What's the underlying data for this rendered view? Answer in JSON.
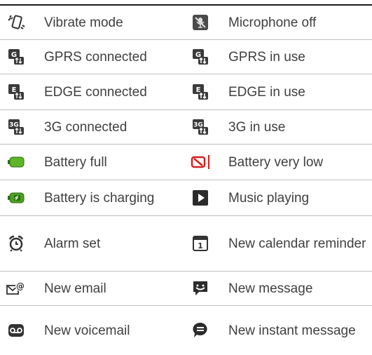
{
  "rows": [
    {
      "left": {
        "icon": "vibrate-icon",
        "label": "Vibrate mode"
      },
      "right": {
        "icon": "microphone-off-icon",
        "label": "Microphone off"
      }
    },
    {
      "left": {
        "icon": "gprs-connected-icon",
        "label": "GPRS connected"
      },
      "right": {
        "icon": "gprs-in-use-icon",
        "label": "GPRS in use"
      }
    },
    {
      "left": {
        "icon": "edge-connected-icon",
        "label": "EDGE connected"
      },
      "right": {
        "icon": "edge-in-use-icon",
        "label": "EDGE in use"
      }
    },
    {
      "left": {
        "icon": "3g-connected-icon",
        "label": "3G connected"
      },
      "right": {
        "icon": "3g-in-use-icon",
        "label": "3G in use"
      }
    },
    {
      "left": {
        "icon": "battery-full-icon",
        "label": "Battery full"
      },
      "right": {
        "icon": "battery-very-low-icon",
        "label": "Battery very low"
      }
    },
    {
      "left": {
        "icon": "battery-charging-icon",
        "label": "Battery is charging"
      },
      "right": {
        "icon": "music-playing-icon",
        "label": "Music playing"
      }
    },
    {
      "left": {
        "icon": "alarm-icon",
        "label": "Alarm set"
      },
      "right": {
        "icon": "calendar-icon",
        "label": "New calendar reminder"
      }
    },
    {
      "left": {
        "icon": "email-icon",
        "label": "New email"
      },
      "right": {
        "icon": "message-icon",
        "label": "New message"
      }
    },
    {
      "left": {
        "icon": "voicemail-icon",
        "label": "New voicemail"
      },
      "right": {
        "icon": "instant-message-icon",
        "label": "New instant message"
      }
    }
  ],
  "colors": {
    "text": "#404040",
    "rule": "#bfbfbf",
    "battery_green": "#5fb52a",
    "battery_red": "#d22020"
  }
}
